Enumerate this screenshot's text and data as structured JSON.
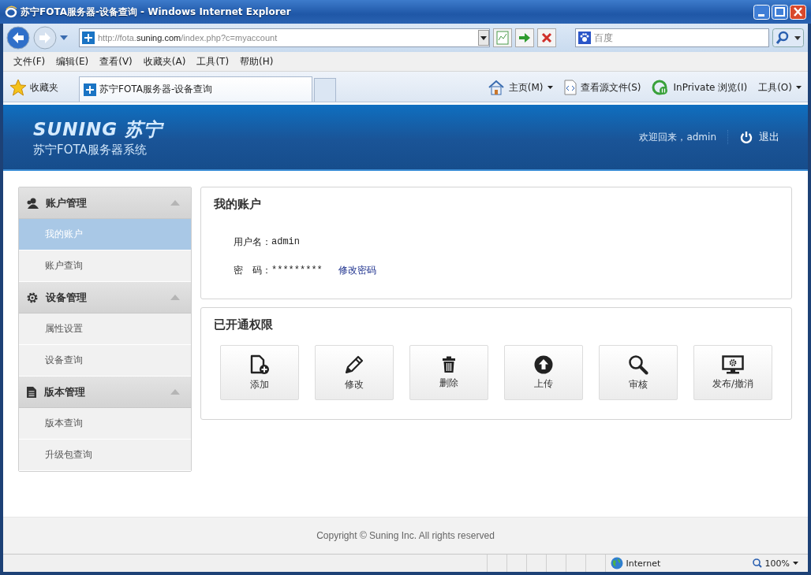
{
  "window": {
    "title": "苏宁FOTA服务器-设备查询 - Windows Internet Explorer"
  },
  "browser": {
    "address": {
      "host_before": "http://fota.",
      "host": "suning.com",
      "path": "/index.php?c=myaccount"
    },
    "search": {
      "placeholder": "百度"
    },
    "menu": [
      "文件(F)",
      "编辑(E)",
      "查看(V)",
      "收藏夹(A)",
      "工具(T)",
      "帮助(H)"
    ],
    "favorites": {
      "label": "收藏夹"
    },
    "tabs": [
      {
        "title": "苏宁FOTA服务器-设备查询",
        "selected": true
      }
    ],
    "commands": [
      {
        "kind": "home",
        "label": "主页(M)"
      },
      {
        "kind": "source",
        "label": "查看源文件(S)"
      },
      {
        "kind": "inprivate",
        "label": "InPrivate 浏览(I)"
      },
      {
        "kind": "tools",
        "label": "工具(O)"
      }
    ]
  },
  "page": {
    "header": {
      "logo": "SUNING 苏宁",
      "subtitle": "苏宁FOTA服务器系统",
      "welcome": "欢迎回来，admin",
      "logout": "退出"
    },
    "sidebar": [
      {
        "title": "账户管理",
        "kind": "user",
        "expanded": true,
        "items": [
          {
            "label": "我的账户",
            "selected": true
          },
          {
            "label": "账户查询",
            "selected": false
          }
        ]
      },
      {
        "title": "设备管理",
        "kind": "gear",
        "expanded": true,
        "items": [
          {
            "label": "属性设置",
            "selected": false
          },
          {
            "label": "设备查询",
            "selected": false
          }
        ]
      },
      {
        "title": "版本管理",
        "kind": "document",
        "expanded": true,
        "items": [
          {
            "label": "版本查询",
            "selected": false
          },
          {
            "label": "升级包查询",
            "selected": false
          }
        ]
      }
    ],
    "account": {
      "title": "我的账户",
      "fields": [
        {
          "label": "用户名：",
          "value": "admin"
        },
        {
          "label": "密　码：",
          "value": "*********",
          "link": "修改密码"
        }
      ]
    },
    "permissions": {
      "title": "已开通权限",
      "items": [
        {
          "kind": "add",
          "label": "添加"
        },
        {
          "kind": "edit",
          "label": "修改"
        },
        {
          "kind": "delete",
          "label": "删除"
        },
        {
          "kind": "upload",
          "label": "上传"
        },
        {
          "kind": "review",
          "label": "审核"
        },
        {
          "kind": "publish",
          "label": "发布/撤消"
        }
      ]
    },
    "footer": "Copyright © Suning Inc. All rights reserved"
  },
  "status_bar": {
    "zone": "Internet",
    "zoom": "100%"
  }
}
